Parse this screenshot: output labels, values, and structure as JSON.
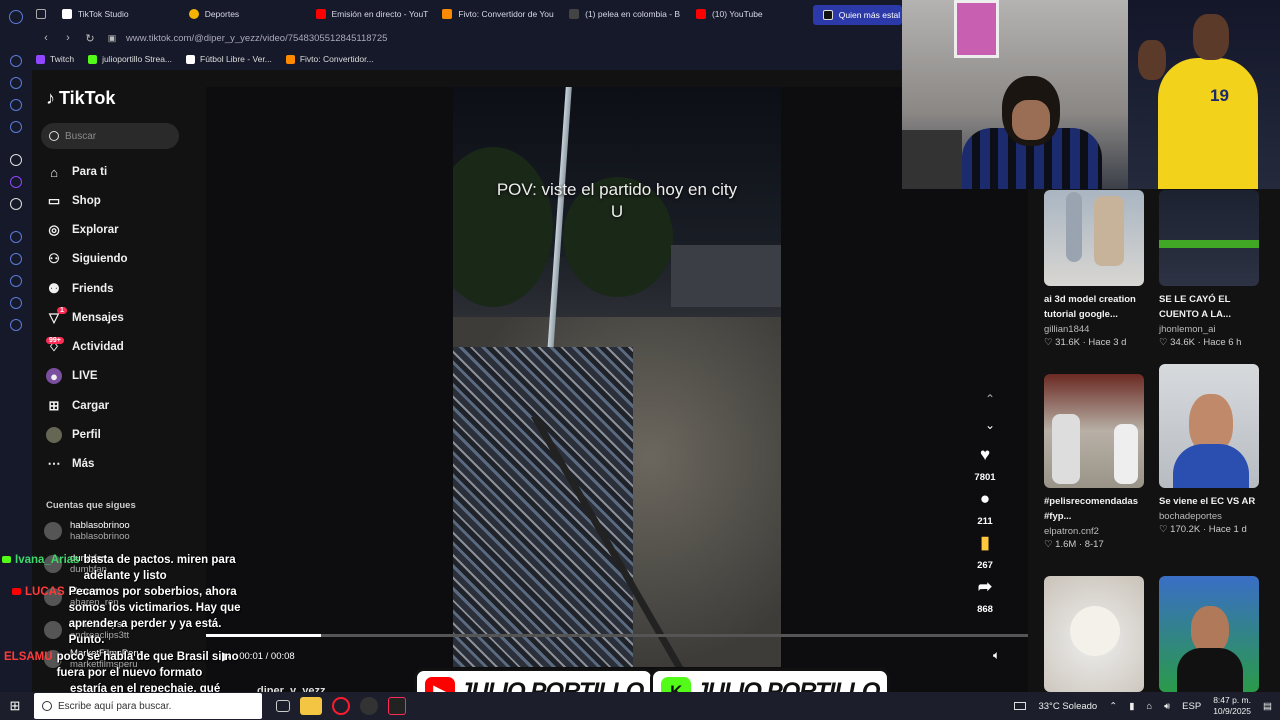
{
  "browser": {
    "tabs": [
      {
        "label": "TikTok Studio",
        "color": "#111111"
      },
      {
        "label": "Deportes",
        "color": "#f4b400"
      },
      {
        "label": "Emisión en directo - YouT",
        "color": "#ff0000"
      },
      {
        "label": "Fivto: Convertidor de You",
        "color": "#ff8a00"
      },
      {
        "label": "(1) pelea en colombia - B",
        "color": "#222222"
      },
      {
        "label": "(10) YouTube",
        "color": "#ff0000"
      },
      {
        "label": "Quien más estal",
        "color": "#111111"
      }
    ],
    "url": "www.tiktok.com/@diper_y_yezz/video/7548305512845118725",
    "bookmarks": [
      {
        "label": "Twitch",
        "color": "#9146ff"
      },
      {
        "label": "julioportillo Strea...",
        "color": "#53fc18"
      },
      {
        "label": "Fútbol Libre - Ver...",
        "color": "#ffffff"
      },
      {
        "label": "Fivto: Convertidor...",
        "color": "#ff8a00"
      }
    ]
  },
  "tiktok": {
    "logo": "TikTok",
    "search_placeholder": "Buscar",
    "nav": [
      {
        "label": "Para ti",
        "icon": "home-icon"
      },
      {
        "label": "Shop",
        "icon": "bag-icon"
      },
      {
        "label": "Explorar",
        "icon": "compass-icon"
      },
      {
        "label": "Siguiendo",
        "icon": "following-icon"
      },
      {
        "label": "Friends",
        "icon": "friends-icon"
      },
      {
        "label": "Mensajes",
        "icon": "message-icon",
        "badge": "1"
      },
      {
        "label": "Actividad",
        "icon": "activity-icon",
        "badge": "99+"
      },
      {
        "label": "LIVE",
        "icon": "live-icon"
      },
      {
        "label": "Cargar",
        "icon": "upload-icon"
      },
      {
        "label": "Perfil",
        "icon": "profile-icon"
      },
      {
        "label": "Más",
        "icon": "more-icon"
      }
    ],
    "following_title": "Cuentas que sigues",
    "following": [
      {
        "name": "hablasobrinoo",
        "user": "hablasobrinoo"
      },
      {
        "name": "dumbfan",
        "user": "dumbfan"
      },
      {
        "name": "aharen",
        "user": "aharen_ren"
      },
      {
        "name": "AndreaClips",
        "user": "andreaclips3tt"
      },
      {
        "name": "MarketFilmsPeru",
        "user": "marketfilmsperu"
      }
    ]
  },
  "video": {
    "caption": "POV: viste el partido hoy en city U",
    "likes": "7801",
    "comments": "211",
    "saves": "267",
    "shares": "868",
    "time": "00:01 / 00:08",
    "progress": 0.14,
    "author_peek": "diper_y_yezz"
  },
  "recommended": [
    {
      "title": "ai 3d model creation tutorial google...",
      "user": "gillian1844",
      "meta": "31.6K · Hace 3 d"
    },
    {
      "title": "SE LE CAYÓ EL CUENTO A LA...",
      "user": "jhonlemon_ai",
      "meta": "34.6K · Hace 6 h"
    },
    {
      "title": "#pelisrecomendadas #fyp...",
      "user": "elpatron.cnf2",
      "meta": "1.6M · 8-17"
    },
    {
      "title": "Se viene el EC VS AR",
      "user": "bochadeportes",
      "meta": "170.2K · Hace 1 d"
    },
    {
      "title": "",
      "user": "",
      "meta": ""
    },
    {
      "title": "",
      "user": "",
      "meta": ""
    }
  ],
  "chat": [
    {
      "name": "Ivana_Arias",
      "msg": "basta de pactos. miren para adelante y listo",
      "platform": "kick"
    },
    {
      "name": "LUCAS",
      "msg": "Pecamos por soberbios, ahora somos los victimarios. Hay que aprender a perder y ya está. Punto.",
      "platform": "youtube"
    },
    {
      "name": "ELSAMU",
      "msg": "poco se habla de que Brasil si no fuera por el nuevo formato",
      "platform": "kick"
    },
    {
      "name": "",
      "msg": "estaría en el repechaje, qué",
      "platform": "youtube"
    }
  ],
  "banner": {
    "left_text": "JULIO PORTILLO",
    "right_text": "JULIO PORTILLO",
    "left_color": "#ff0000",
    "right_color": "#53fc18"
  },
  "taskbar": {
    "search_placeholder": "Escribe aquí para buscar.",
    "weather": "33°C  Soleado",
    "lang": "ESP",
    "time": "8:47 p. m.",
    "date": "10/9/2025"
  },
  "cam_jersey_number": "19"
}
